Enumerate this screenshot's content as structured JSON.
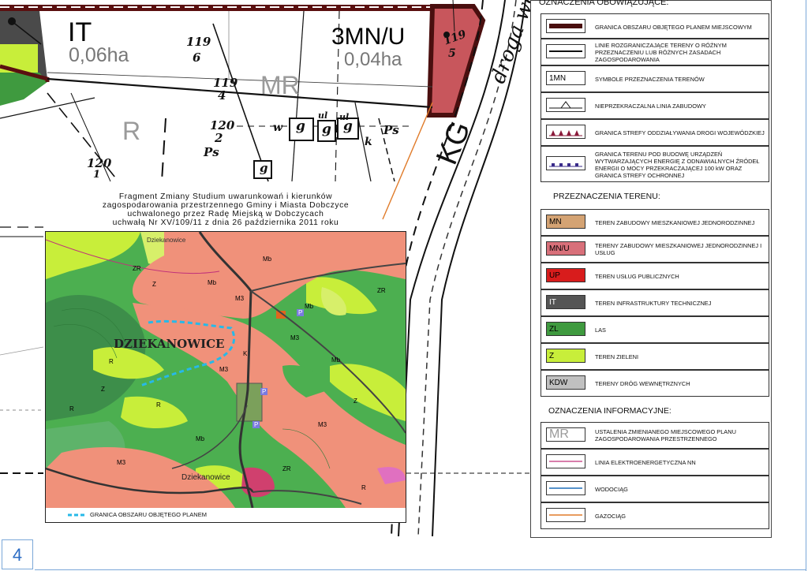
{
  "map": {
    "zones": {
      "it_symbol": "IT",
      "it_area": "0,06ha",
      "mnu_symbol": "3MN/U",
      "mnu_area": "0,04ha",
      "mr_label": "MR",
      "r_label": "R",
      "kg_label": "KG",
      "road_label": "droga wo"
    },
    "parcels": {
      "p1_num": "119",
      "p1_den": "6",
      "p2_num": "119",
      "p2_den": "4",
      "p3_num": "120",
      "p3_den": "2",
      "p4_num": "120",
      "p4_den": "1",
      "p5": "Ps",
      "p6": "Ps",
      "p7_num": "119",
      "p7_den": "5",
      "building": "g",
      "b2": "g",
      "b3": "g",
      "b4": "g",
      "b5": "ul",
      "b6": "ul",
      "k": "k",
      "w": "w"
    }
  },
  "inset": {
    "title_lines": [
      "Fragment Zmiany Studium uwarunkowań i kierunków",
      "zagospodarowania przestrzennego Gminy i Miasta Dobczyce",
      "uchwalonego przez Radę Miejską w Dobczycach",
      "uchwałą Nr XV/109/11 z dnia 26 października 2011 roku"
    ],
    "village_name": "DZIEKANOWICE",
    "village_small": "Dziekanowice",
    "village_small2": "Dziekanowice",
    "legend_text": "GRANICA OBSZARU OBJĘTEGO PLANEM",
    "labels": [
      "Mb",
      "Mb",
      "Mb",
      "Mb",
      "Mb",
      "R",
      "R",
      "R",
      "R",
      "ZR",
      "ZR",
      "ZR",
      "Z",
      "Z",
      "Z",
      "M3",
      "M3",
      "M3",
      "M3",
      "M3",
      "K",
      "P",
      "P",
      "P"
    ]
  },
  "legend": {
    "head_obligatory": "OZNACZENIA OBOWIĄZUJĄCE:",
    "head_purposes": "PRZEZNACZENIA TERENU:",
    "head_info": "OZNACZENIA INFORMACYJNE:",
    "obligatory": [
      {
        "symbol": "",
        "label": "GRANICA OBSZARU OBJĘTEGO PLANEM MIEJSCOWYM"
      },
      {
        "symbol": "",
        "label": "LINIE ROZGRANICZAJĄCE TERENY O RÓŻNYM PRZEZNACZENIU LUB RÓŻNYCH ZASADACH ZAGOSPODAROWANIA"
      },
      {
        "symbol": "1MN",
        "label": "SYMBOLE PRZEZNACZENIA TERENÓW"
      },
      {
        "symbol": "",
        "label": "NIEPRZEKRACZALNA LINIA ZABUDOWY"
      },
      {
        "symbol": "",
        "label": "GRANICA STREFY ODDZIAŁYWANIA DROGI WOJEWÓDZKIEJ"
      },
      {
        "symbol": "",
        "label": "GRANICA TERENU POD BUDOWĘ URZĄDZEŃ WYTWARZAJĄCYCH ENERGIĘ Z ODNAWIALNYCH ŹRÓDEŁ ENERGII O MOCY PRZEKRACZAJĄCEJ 100 kW ORAZ GRANICA STREFY OCHRONNEJ"
      }
    ],
    "purposes": [
      {
        "symbol": "MN",
        "label": "TEREN ZABUDOWY MIESZKANIOWEJ JEDNORODZINNEJ",
        "color": "#d4a373"
      },
      {
        "symbol": "MN/U",
        "label": "TERENY ZABUDOWY MIESZKANIOWEJ JEDNORODZINNEJ I USŁUG",
        "color": "#d8707a"
      },
      {
        "symbol": "UP",
        "label": "TEREN USŁUG PUBLICZNYCH",
        "color": "#d81c1c"
      },
      {
        "symbol": "IT",
        "label": "TEREN INFRASTRUKTURY TECHNICZNEJ",
        "color": "#555555"
      },
      {
        "symbol": "ZL",
        "label": "LAS",
        "color": "#3f9a3f"
      },
      {
        "symbol": "Z",
        "label": "TEREN ZIELENI",
        "color": "#c8ee3a"
      },
      {
        "symbol": "KDW",
        "label": "TERENY DRÓG WEWNĘTRZNYCH",
        "color": "#c0c0c0"
      }
    ],
    "info": [
      {
        "symbol": "MR",
        "label": "USTALENIA ZMIENIANEGO MIEJSCOWEGO PLANU ZAGOSPODAROWANIA PRZESTRZENNEGO"
      },
      {
        "symbol": "",
        "label": "LINIA ELEKTROENERGETYCZNA NN"
      },
      {
        "symbol": "",
        "label": "WODOCIĄG"
      },
      {
        "symbol": "",
        "label": "GAZOCIĄG"
      }
    ]
  },
  "page_number": "4"
}
